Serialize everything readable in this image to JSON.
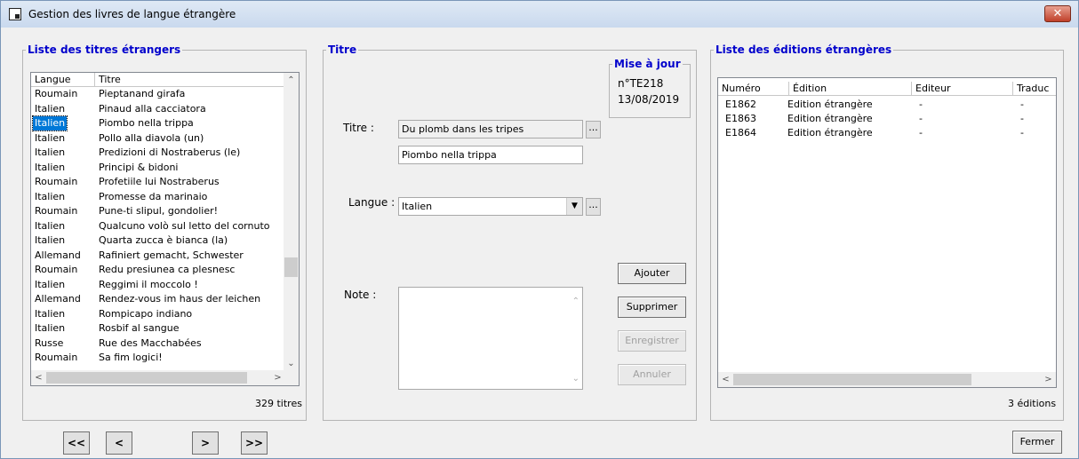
{
  "window": {
    "title": "Gestion des livres de langue étrangère",
    "close": "✕"
  },
  "left": {
    "legend": "Liste des titres étrangers",
    "headers": [
      "Langue",
      "Titre"
    ],
    "rows": [
      {
        "langue": "Roumain",
        "titre": "Pieptanand girafa"
      },
      {
        "langue": "Italien",
        "titre": "Pinaud alla cacciatora"
      },
      {
        "langue": "Italien",
        "titre": "Piombo nella trippa",
        "selected": true
      },
      {
        "langue": "Italien",
        "titre": "Pollo alla diavola (un)"
      },
      {
        "langue": "Italien",
        "titre": "Predizioni di Nostraberus (le)"
      },
      {
        "langue": "Italien",
        "titre": "Principi & bidoni"
      },
      {
        "langue": "Roumain",
        "titre": "Profetiile lui Nostraberus"
      },
      {
        "langue": "Italien",
        "titre": "Promesse da marinaio"
      },
      {
        "langue": "Roumain",
        "titre": "Pune-ti slipul, gondolier!"
      },
      {
        "langue": "Italien",
        "titre": "Qualcuno volò sul letto del cornuto"
      },
      {
        "langue": "Italien",
        "titre": "Quarta zucca è bianca (la)"
      },
      {
        "langue": "Allemand",
        "titre": "Rafiniert gemacht, Schwester"
      },
      {
        "langue": "Roumain",
        "titre": "Redu presiunea ca plesnesc"
      },
      {
        "langue": "Italien",
        "titre": "Reggimi il moccolo !"
      },
      {
        "langue": "Allemand",
        "titre": "Rendez-vous im haus der leichen"
      },
      {
        "langue": "Italien",
        "titre": "Rompicapo indiano"
      },
      {
        "langue": "Italien",
        "titre": "Rosbif al sangue"
      },
      {
        "langue": "Russe",
        "titre": "Rue des Macchabées"
      },
      {
        "langue": "Roumain",
        "titre": "Sa fim logici!"
      }
    ],
    "count": "329 titres"
  },
  "nav": {
    "first": "<<",
    "prev": "<",
    "next": ">",
    "last": ">>"
  },
  "middle": {
    "legend": "Titre",
    "update": {
      "legend": "Mise à jour",
      "number": "n°TE218",
      "date": "13/08/2019"
    },
    "titre_label": "Titre :",
    "titre_original": "Du plomb dans les tripes",
    "titre_etranger": "Piombo nella trippa",
    "langue_label": "Langue :",
    "langue_value": "Italien",
    "note_label": "Note :",
    "dots": "...",
    "buttons": {
      "ajouter": "Ajouter",
      "supprimer": "Supprimer",
      "enregistrer": "Enregistrer",
      "annuler": "Annuler"
    }
  },
  "right": {
    "legend": "Liste des éditions étrangères",
    "headers": [
      "Numéro",
      "Édition",
      "Editeur",
      "Traduc"
    ],
    "rows": [
      [
        "E1862",
        "Edition étrangère",
        "-",
        "-"
      ],
      [
        "E1863",
        "Edition étrangère",
        "-",
        "-"
      ],
      [
        "E1864",
        "Edition étrangère",
        "-",
        "-"
      ]
    ],
    "count": "3 éditions"
  },
  "fermer": "Fermer",
  "icons": {
    "scroll_up": "up-arrow",
    "scroll_down": "down-arrow",
    "scroll_left": "left-arrow",
    "scroll_right": "right-arrow",
    "combo": "dropdown-arrow"
  }
}
